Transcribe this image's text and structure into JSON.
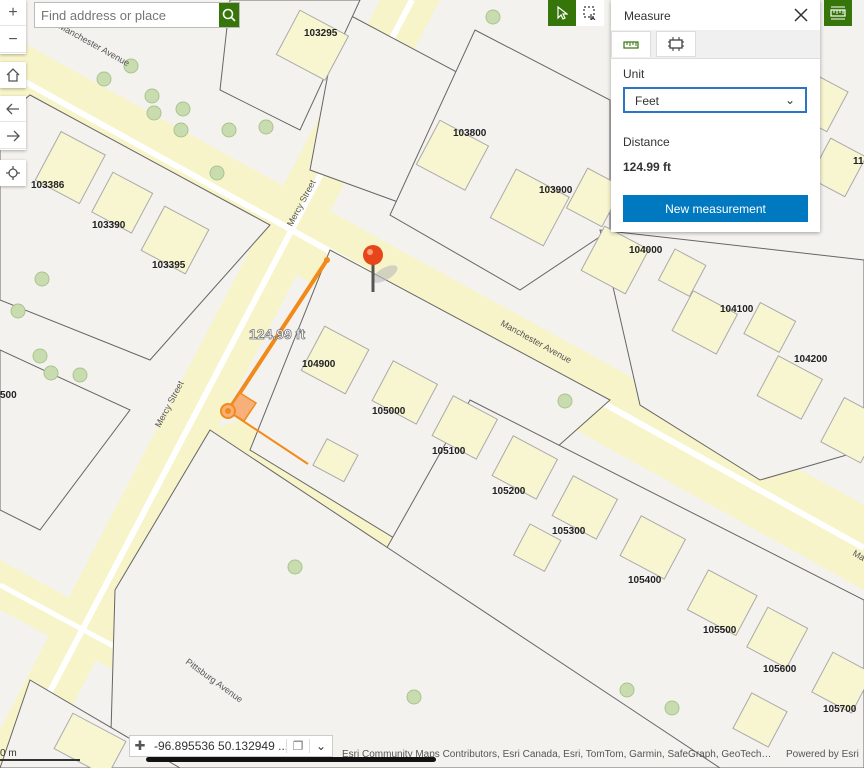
{
  "search": {
    "placeholder": "Find address or place"
  },
  "nav": {
    "zoom_in": "+",
    "zoom_out": "−"
  },
  "parcels": [
    "103295",
    "103386",
    "103390",
    "103395",
    "103800",
    "103900",
    "104000",
    "104100",
    "104200",
    "104900",
    "105000",
    "105100",
    "105200",
    "105300",
    "105400",
    "105500",
    "105600",
    "105700",
    "11",
    "500"
  ],
  "streets": {
    "manchester_top": "Manchester Avenue",
    "manchester": "Manchester Avenue",
    "mercy_top": "Mercy Street",
    "mercy_bottom": "Mercy Street",
    "pittsburg": "Pittsburg Avenue",
    "edge_right": "Ma"
  },
  "measure_label": "124.99 ft",
  "measure_panel": {
    "title": "Measure",
    "unit_label": "Unit",
    "unit_value": "Feet",
    "distance_label": "Distance",
    "distance_value": "124.99 ft",
    "new_button": "New measurement"
  },
  "coordinates": "-96.895536 50.132949 ...",
  "attribution": "Esri Community Maps Contributors, Esri Canada, Esri, TomTom, Garmin, SafeGraph, GeoTechnologies",
  "powered_by": "Powered by Esri",
  "scale_label": "0 m",
  "colors": {
    "road": "#f7f4c9",
    "parcel": "#f4f2ee",
    "building": "#f8f6d0",
    "tree": "#c8dcb0",
    "accent": "#35750a",
    "measure": "#f28a1b",
    "button": "#0079c1"
  }
}
